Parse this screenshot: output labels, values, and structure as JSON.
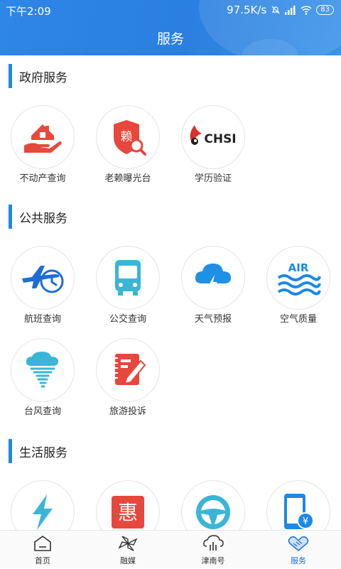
{
  "status_bar": {
    "time": "下午2:09",
    "speed": "97.5K/s",
    "battery": "83"
  },
  "header": {
    "title": "服务"
  },
  "sections": [
    {
      "title": "政府服务",
      "items": [
        {
          "label": "不动产查询",
          "icon": "house-hand-icon"
        },
        {
          "label": "老赖曝光台",
          "icon": "shield-search-icon"
        },
        {
          "label": "学历验证",
          "icon": "chsi-logo-icon",
          "logo_text": "CHSI"
        }
      ]
    },
    {
      "title": "公共服务",
      "items": [
        {
          "label": "航班查询",
          "icon": "airplane-clock-icon"
        },
        {
          "label": "公交查询",
          "icon": "bus-icon"
        },
        {
          "label": "天气预报",
          "icon": "cloud-lightning-icon"
        },
        {
          "label": "空气质量",
          "icon": "air-waves-icon",
          "logo_text": "AIR"
        },
        {
          "label": "台风查询",
          "icon": "typhoon-icon"
        },
        {
          "label": "旅游投诉",
          "icon": "notebook-pen-icon"
        }
      ]
    },
    {
      "title": "生活服务",
      "items": [
        {
          "label": "",
          "icon": "lightning-icon"
        },
        {
          "label": "",
          "icon": "discount-icon",
          "logo_text": "惠"
        },
        {
          "label": "",
          "icon": "steering-wheel-icon"
        },
        {
          "label": "",
          "icon": "phone-payment-icon",
          "logo_text": "¥"
        }
      ]
    }
  ],
  "tabbar": [
    {
      "label": "首页",
      "icon": "home-icon",
      "active": false
    },
    {
      "label": "融媒",
      "icon": "pinwheel-icon",
      "active": false
    },
    {
      "label": "津南号",
      "icon": "cloud-building-icon",
      "active": false
    },
    {
      "label": "服务",
      "icon": "handshake-icon",
      "active": true
    }
  ],
  "colors": {
    "header": "#2a7fe0",
    "accent": "#1e88e5",
    "red": "#e8473c",
    "cyan": "#3bb5d6"
  }
}
